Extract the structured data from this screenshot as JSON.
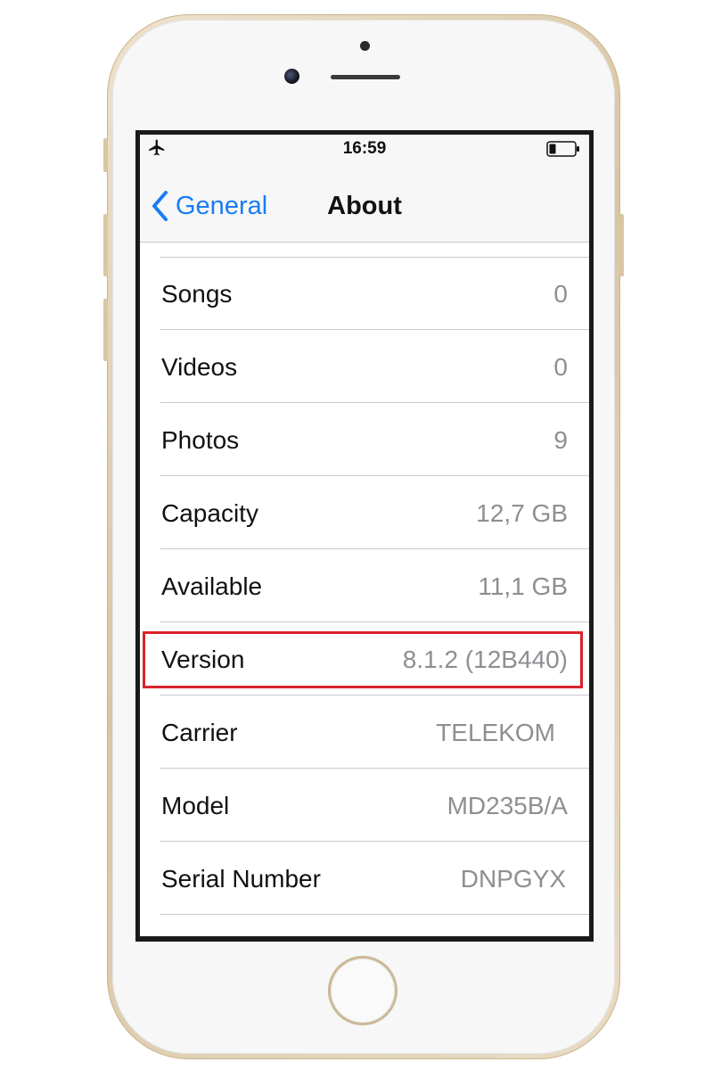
{
  "status_bar": {
    "time": "16:59",
    "left_icon": "airplane-icon",
    "right_icon": "battery-icon"
  },
  "nav": {
    "back_label": "General",
    "back_icon": "chevron-left-icon",
    "title": "About",
    "accent_color": "#1a7cf5"
  },
  "rows": [
    {
      "label": "Songs",
      "value": "0"
    },
    {
      "label": "Videos",
      "value": "0"
    },
    {
      "label": "Photos",
      "value": "9"
    },
    {
      "label": "Capacity",
      "value": "12,7 GB"
    },
    {
      "label": "Available",
      "value": "11,1 GB"
    },
    {
      "label": "Version",
      "value": "8.1.2 (12B440)"
    },
    {
      "label": "Carrier",
      "value": "TELEKOM"
    },
    {
      "label": "Model",
      "value": "MD235B/A"
    },
    {
      "label": "Serial Number",
      "value": "DNPGYX"
    }
  ],
  "highlight": {
    "row_label": "Version",
    "color": "#d9232d"
  },
  "device": {
    "color": "gold"
  }
}
